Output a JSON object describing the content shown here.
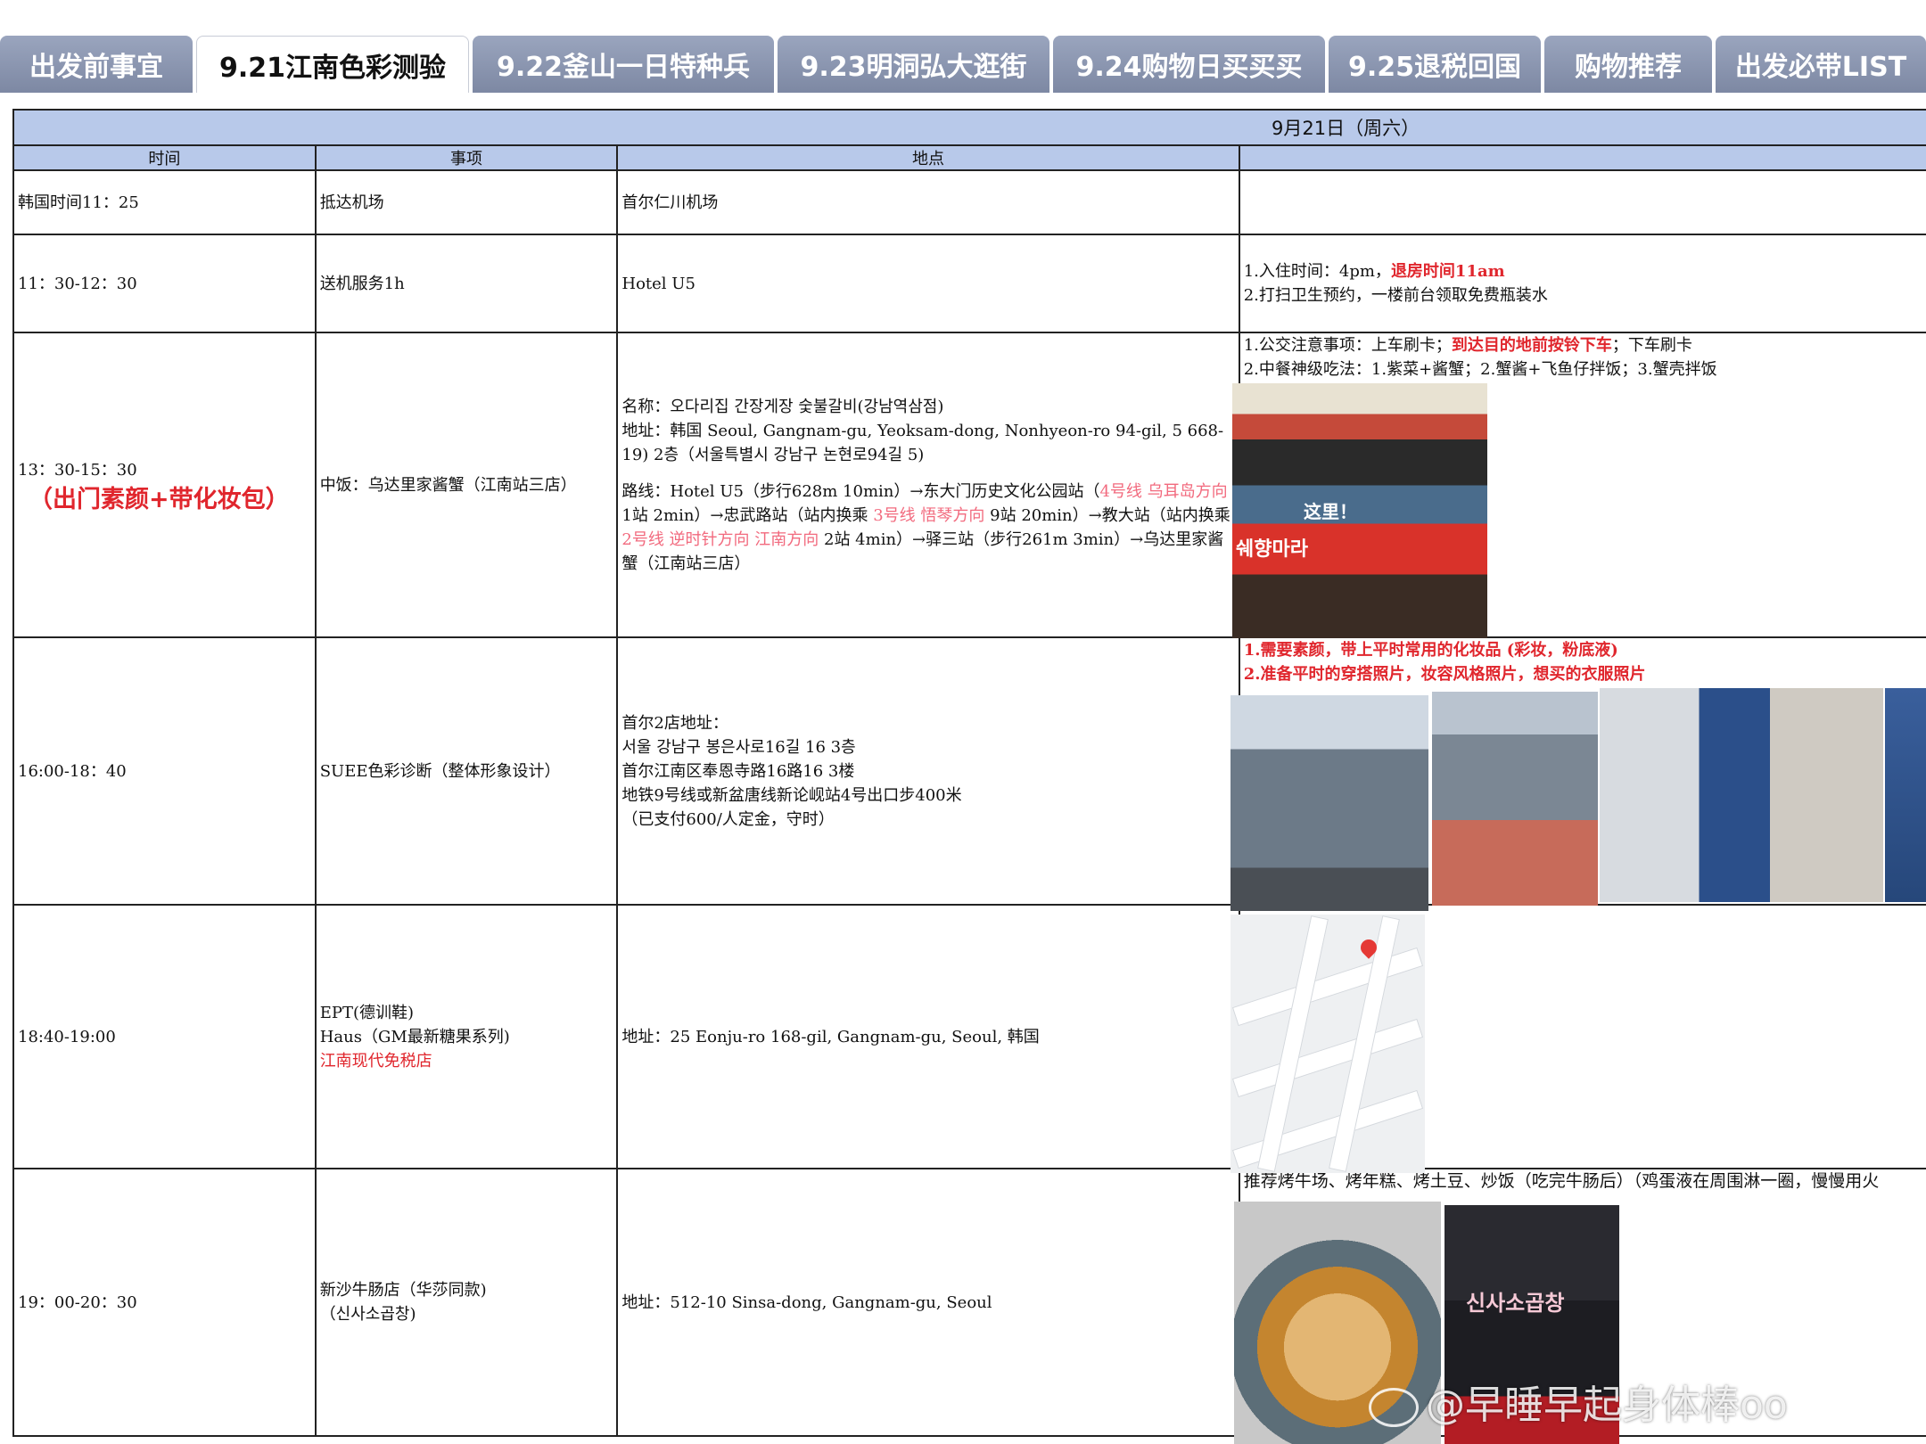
{
  "tabs": [
    {
      "label": "出发前事宜",
      "active": false
    },
    {
      "label": "9.21江南色彩测验",
      "active": true
    },
    {
      "label": "9.22釜山一日特种兵",
      "active": false
    },
    {
      "label": "9.23明洞弘大逛街",
      "active": false
    },
    {
      "label": "9.24购物日买买买",
      "active": false
    },
    {
      "label": "9.25退税回国",
      "active": false
    },
    {
      "label": "购物推荐",
      "active": false
    },
    {
      "label": "出发必带LIST",
      "active": false
    }
  ],
  "sheet": {
    "date_header": "9月21日（周六）",
    "columns": [
      "时间",
      "事项",
      "地点"
    ],
    "rows": [
      {
        "time": "韩国时间11：25",
        "item": "抵达机场",
        "place": "首尔仁川机场"
      },
      {
        "time": "11：30-12：30",
        "item": "送机服务1h",
        "place": "Hotel U5",
        "note_1_prefix": "1.入住时间：4pm，",
        "note_1_red": "退房时间11am",
        "note_2": "2.打扫卫生预约，一楼前台领取免费瓶装水"
      },
      {
        "time": "13：30-15：30",
        "time_note": "（出门素颜+带化妆包）",
        "item": "中饭：乌达里家酱蟹（江南站三店）",
        "place_name": "名称：오다리집 간장게장 숯불갈비(강남역삼점)",
        "place_addr": "地址：韩国 Seoul, Gangnam-gu, Yeoksam-dong, Nonhyeon-ro 94-gil, 5 668-19) 2층（서울특별시 강남구 논현로94길 5)",
        "route_a": "路线：Hotel U5（步行628m 10min）→东大门历史文化公园站（",
        "route_b": "4号线 乌耳岛方向",
        "route_c": " 1站 2min）→忠武路站（站内换乘 ",
        "route_d": "3号线 悟琴方向",
        "route_e": " 9站 20min）→教大站（站内换乘 ",
        "route_f": "2号线 逆时针方向 江南方向",
        "route_g": " 2站 4min）→驿三站（步行261m 3min）→乌达里家酱蟹（江南站三店）",
        "note_1_prefix": "1.公交注意事项：上车刷卡；",
        "note_1_red": "到达目的地前按铃下车",
        "note_1_suffix": "；下车刷卡",
        "note_2": "2.中餐神级吃法：1.紫菜+酱蟹；2.蟹酱+飞鱼仔拌饭；3.蟹壳拌饭"
      },
      {
        "time": "16:00-18：40",
        "item": "SUEE色彩诊断（整体形象设计）",
        "place_lines": [
          "首尔2店地址：",
          "서울 강남구 봉은사로16길 16  3층",
          "首尔江南区奉恩寺路16路16 3楼",
          "地铁9号线或新盆唐线新论岘站4号出口步400米",
          "（已支付600/人定金，守时）"
        ],
        "note_1": "1.需要素颜，带上平时常用的化妆品 (彩妆，粉底液)",
        "note_2": "2.准备平时的穿搭照片，妆容风格照片，想买的衣服照片"
      },
      {
        "time": "18:40-19:00",
        "item_1": "EPT(德训鞋)",
        "item_2": "Haus（GM最新糖果系列)",
        "item_3": "江南现代免税店",
        "place": "地址：25 Eonju-ro 168-gil, Gangnam-gu, Seoul, 韩国"
      },
      {
        "time": "19：00-20：30",
        "item_1": "新沙牛肠店（华莎同款)",
        "item_2": "（신사소곱창)",
        "place": "地址：512-10 Sinsa-dong, Gangnam-gu, Seoul",
        "note_1": "推荐烤牛场、烤年糕、烤土豆、炒饭（吃完牛肠后）（鸡蛋液在周围淋一圈，慢慢用火"
      }
    ]
  },
  "photo_text": {
    "restaurant_sign": "这里！",
    "restaurant_sign_2": "쉐향마라",
    "shop_sign": "신사소곱창"
  },
  "watermark": "@早睡早起身体棒oo",
  "colors": {
    "tab_bg": "#8a95ae",
    "header_bg": "#b8c9ea",
    "accent_red": "#e0262d",
    "accent_pink": "#f26a7e"
  }
}
